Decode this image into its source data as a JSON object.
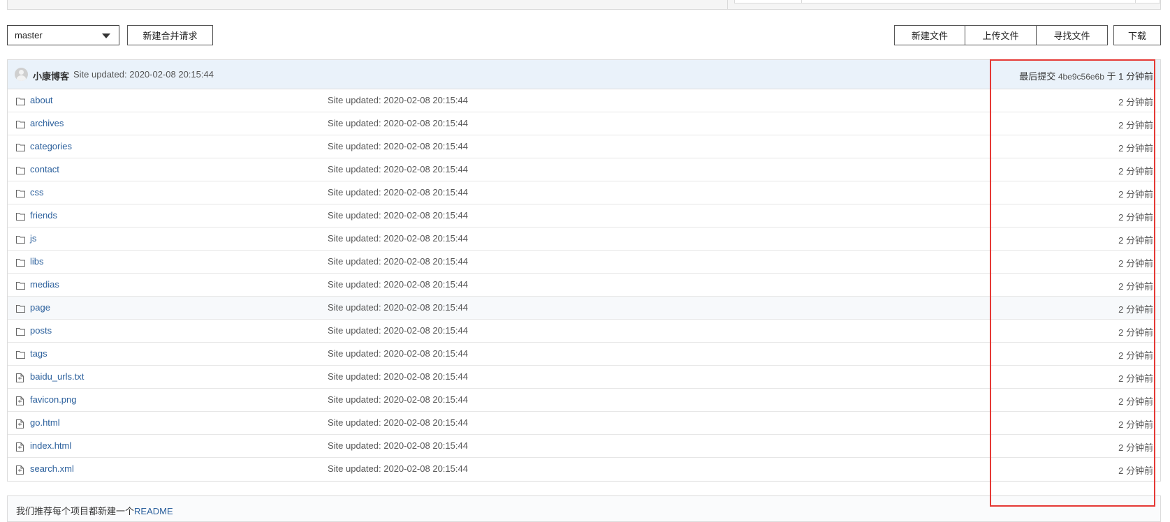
{
  "toolbar": {
    "branch": "master",
    "new_pr_label": "新建合并请求",
    "new_file_label": "新建文件",
    "upload_file_label": "上传文件",
    "find_file_label": "寻找文件",
    "download_label": "下载"
  },
  "commit": {
    "author": "小康博客",
    "message": "Site updated: 2020-02-08 20:15:44",
    "last_commit_prefix": "最后提交",
    "sha": "4be9c56e6b",
    "last_commit_suffix": "于 1 分钟前"
  },
  "files": [
    {
      "name": "about",
      "type": "folder",
      "message": "Site updated: 2020-02-08 20:15:44",
      "time": "2 分钟前"
    },
    {
      "name": "archives",
      "type": "folder",
      "message": "Site updated: 2020-02-08 20:15:44",
      "time": "2 分钟前"
    },
    {
      "name": "categories",
      "type": "folder",
      "message": "Site updated: 2020-02-08 20:15:44",
      "time": "2 分钟前"
    },
    {
      "name": "contact",
      "type": "folder",
      "message": "Site updated: 2020-02-08 20:15:44",
      "time": "2 分钟前"
    },
    {
      "name": "css",
      "type": "folder",
      "message": "Site updated: 2020-02-08 20:15:44",
      "time": "2 分钟前"
    },
    {
      "name": "friends",
      "type": "folder",
      "message": "Site updated: 2020-02-08 20:15:44",
      "time": "2 分钟前"
    },
    {
      "name": "js",
      "type": "folder",
      "message": "Site updated: 2020-02-08 20:15:44",
      "time": "2 分钟前"
    },
    {
      "name": "libs",
      "type": "folder",
      "message": "Site updated: 2020-02-08 20:15:44",
      "time": "2 分钟前"
    },
    {
      "name": "medias",
      "type": "folder",
      "message": "Site updated: 2020-02-08 20:15:44",
      "time": "2 分钟前"
    },
    {
      "name": "page",
      "type": "folder",
      "message": "Site updated: 2020-02-08 20:15:44",
      "time": "2 分钟前"
    },
    {
      "name": "posts",
      "type": "folder",
      "message": "Site updated: 2020-02-08 20:15:44",
      "time": "2 分钟前"
    },
    {
      "name": "tags",
      "type": "folder",
      "message": "Site updated: 2020-02-08 20:15:44",
      "time": "2 分钟前"
    },
    {
      "name": "baidu_urls.txt",
      "type": "file",
      "message": "Site updated: 2020-02-08 20:15:44",
      "time": "2 分钟前"
    },
    {
      "name": "favicon.png",
      "type": "file",
      "message": "Site updated: 2020-02-08 20:15:44",
      "time": "2 分钟前"
    },
    {
      "name": "go.html",
      "type": "file",
      "message": "Site updated: 2020-02-08 20:15:44",
      "time": "2 分钟前"
    },
    {
      "name": "index.html",
      "type": "file",
      "message": "Site updated: 2020-02-08 20:15:44",
      "time": "2 分钟前"
    },
    {
      "name": "search.xml",
      "type": "file",
      "message": "Site updated: 2020-02-08 20:15:44",
      "time": "2 分钟前"
    }
  ],
  "readme": {
    "text": "我们推荐每个项目都新建一个",
    "link": "README"
  },
  "colors": {
    "link": "#2a5f9c",
    "header_bg": "#eaf2fa",
    "highlight": "#e53935"
  }
}
